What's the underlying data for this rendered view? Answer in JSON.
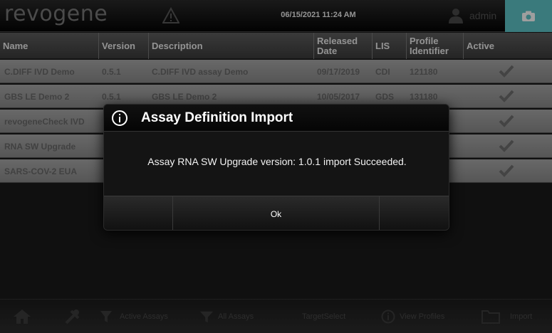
{
  "topbar": {
    "logo": "revogene",
    "datetime": "06/15/2021 11:24 AM",
    "user": "admin"
  },
  "table": {
    "headers": {
      "name": "Name",
      "version": "Version",
      "description": "Description",
      "released_date": "Released Date",
      "lis": "LIS",
      "profile_identifier": "Profile Identifier",
      "active": "Active"
    },
    "rows": [
      {
        "name": "C.DIFF IVD Demo",
        "version": "0.5.1",
        "description": "C.DIFF IVD assay Demo",
        "released_date": "09/17/2019",
        "lis": "CDI",
        "profile": "121180"
      },
      {
        "name": "GBS LE Demo 2",
        "version": "0.5.1",
        "description": "GBS LE Demo 2",
        "released_date": "10/05/2017",
        "lis": "GDS",
        "profile": "131180"
      },
      {
        "name": "revogeneCheck IVD",
        "version": "",
        "description": "",
        "released_date": "",
        "lis": "",
        "profile": ""
      },
      {
        "name": "RNA SW Upgrade",
        "version": "",
        "description": "",
        "released_date": "",
        "lis": "",
        "profile": ""
      },
      {
        "name": "SARS-COV-2 EUA",
        "version": "",
        "description": "",
        "released_date": "",
        "lis": "",
        "profile": ""
      }
    ]
  },
  "bottombar": {
    "active_assays": "Active Assays",
    "all_assays": "All Assays",
    "target_label": "TargetSelect",
    "view_profiles": "View Profiles",
    "import": "Import"
  },
  "dialog": {
    "title": "Assay Definition Import",
    "message": "Assay RNA SW Upgrade version: 1.0.1 import Succeeded.",
    "ok": "Ok"
  },
  "colors": {
    "accent": "#5ec5c8",
    "row_bg": "#9a9a9a",
    "dialog_bg": "#141414"
  }
}
